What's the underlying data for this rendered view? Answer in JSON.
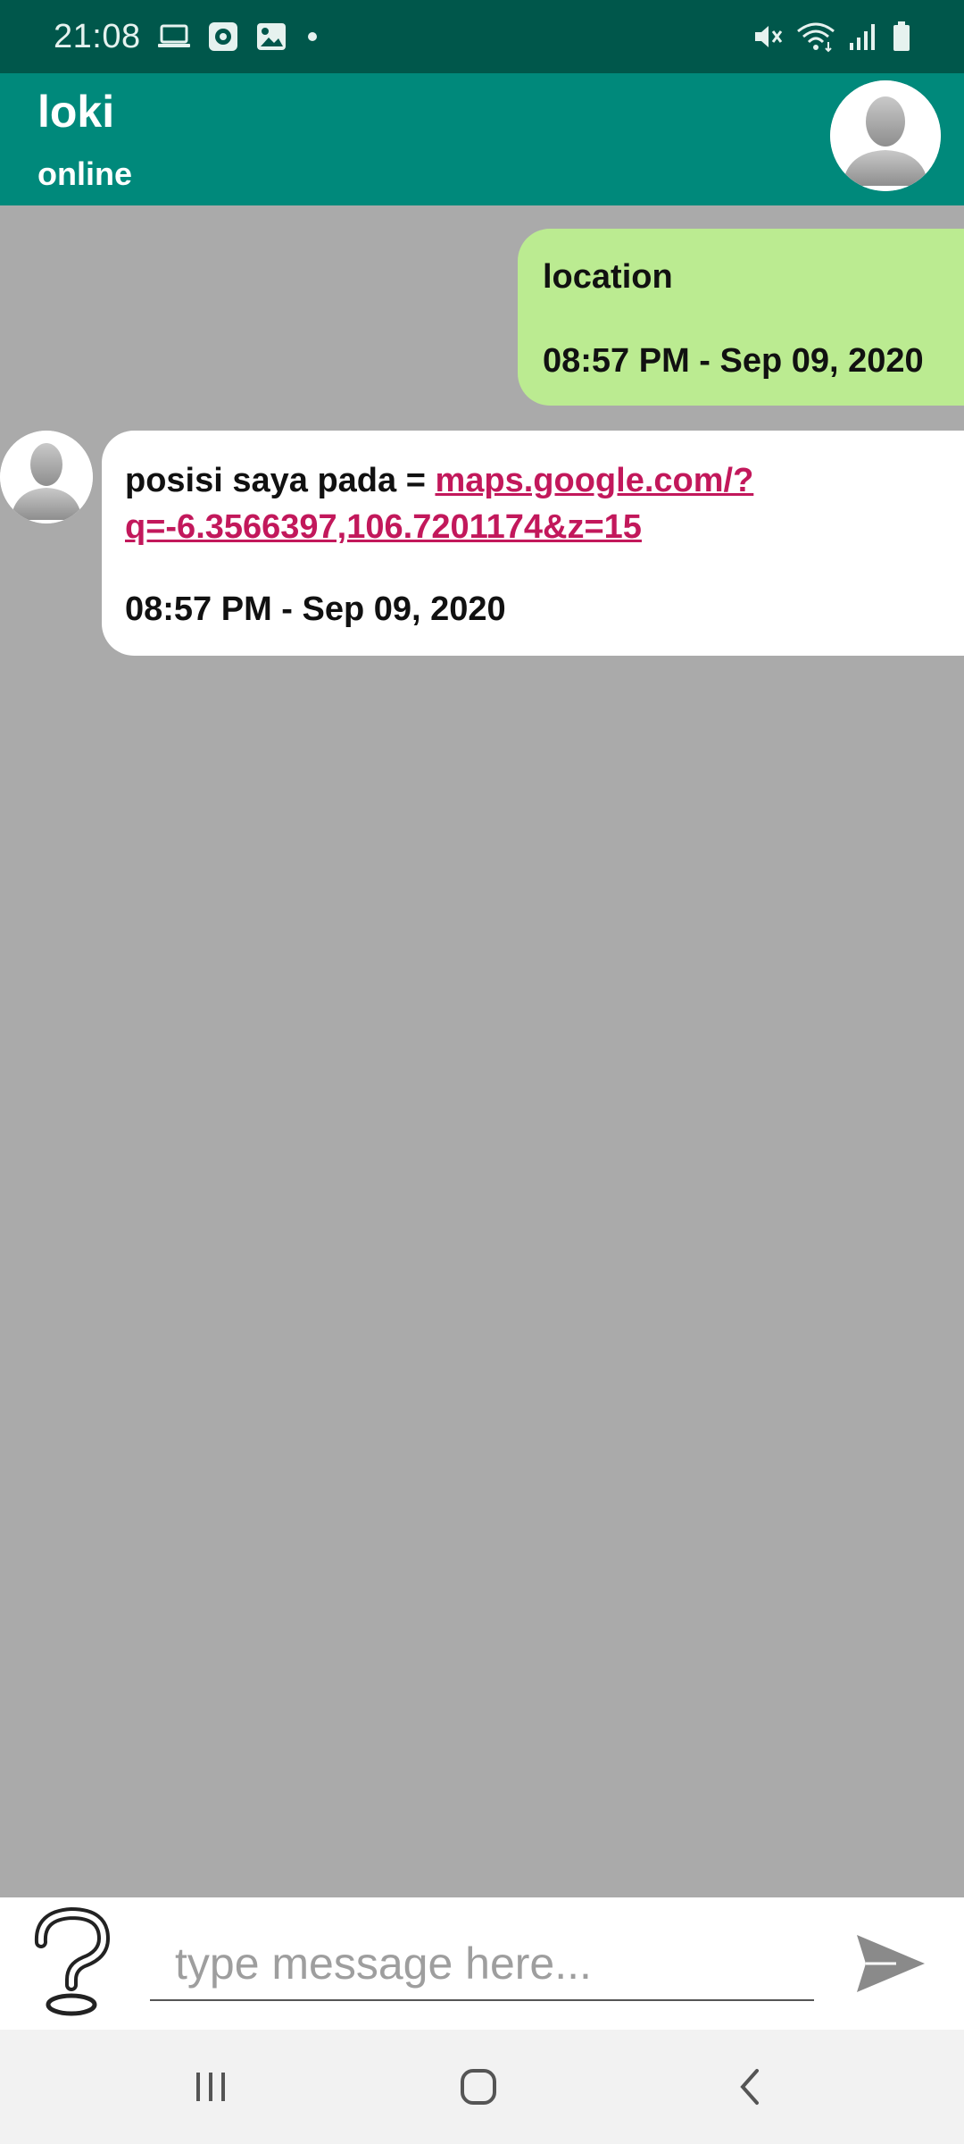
{
  "status_bar": {
    "time": "21:08",
    "left_icons": [
      "laptop-icon",
      "record-icon",
      "image-icon",
      "dot-icon"
    ],
    "right_icons": [
      "mute-icon",
      "wifi-icon",
      "signal-icon",
      "battery-icon"
    ]
  },
  "header": {
    "name": "loki",
    "status": "online",
    "avatar_icon": "avatar-icon"
  },
  "messages": [
    {
      "direction": "outgoing",
      "text": "location",
      "time": "08:57 PM - Sep 09, 2020"
    },
    {
      "direction": "incoming",
      "text_prefix": "posisi saya pada = ",
      "link_line1": "maps.google.com/?",
      "link_line2": "q=-6.3566397,106.7201174&z=15",
      "time": "08:57 PM - Sep 09, 2020"
    }
  ],
  "composer": {
    "placeholder": "type message here...",
    "value": "",
    "help_icon": "question-mark-icon",
    "send_icon": "send-icon"
  },
  "nav_bar": {
    "icons": [
      "recent-apps-icon",
      "home-icon",
      "back-icon"
    ]
  },
  "colors": {
    "status_bar": "#00574b",
    "header": "#00897b",
    "chat_background": "#aaaaaa",
    "outgoing_bubble": "#bbeb91",
    "incoming_bubble": "#ffffff",
    "link": "#c2185b"
  }
}
